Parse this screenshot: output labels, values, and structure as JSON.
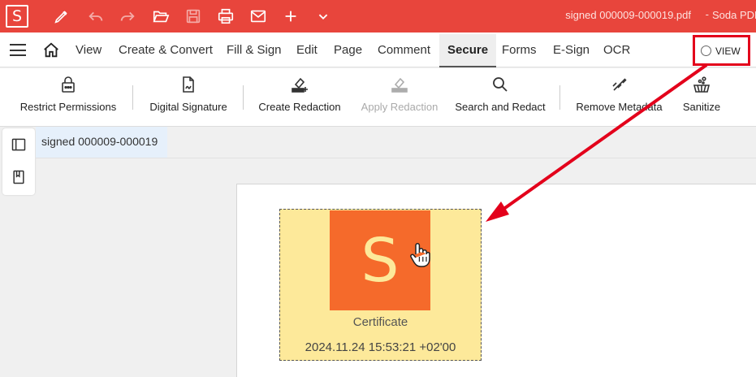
{
  "titlebar": {
    "logo": "S",
    "icons": [
      "pen-icon",
      "undo-icon",
      "redo-icon",
      "open-folder-icon",
      "save-icon",
      "print-icon",
      "mail-icon",
      "plus-icon",
      "chevron-down-icon"
    ],
    "doc_title": "signed 000009-000019.pdf",
    "separator": "-",
    "app_name": "Soda PDF",
    "bg_color": "#e8453c"
  },
  "menu": {
    "items": [
      "View",
      "Create & Convert",
      "Fill & Sign",
      "Edit",
      "Page",
      "Comment",
      "Secure",
      "Forms",
      "E-Sign",
      "OCR"
    ],
    "active": "Secure",
    "view_toggle": "VIEW"
  },
  "ribbon": {
    "buttons": [
      {
        "label": "Restrict Permissions",
        "icon": "lock-icon",
        "enabled": true
      },
      {
        "label": "Digital Signature",
        "icon": "signed-document-icon",
        "enabled": true
      },
      {
        "label": "Create Redaction",
        "icon": "redaction-create-icon",
        "enabled": true
      },
      {
        "label": "Apply Redaction",
        "icon": "redaction-apply-icon",
        "enabled": false
      },
      {
        "label": "Search and Redact",
        "icon": "search-icon",
        "enabled": true
      },
      {
        "label": "Remove Metadata",
        "icon": "remove-metadata-icon",
        "enabled": true
      },
      {
        "label": "Sanitize",
        "icon": "sanitize-icon",
        "enabled": true
      }
    ]
  },
  "document_tab": {
    "label": "signed 000009-000019"
  },
  "signature": {
    "logo_letter": "S",
    "caption": "Certificate",
    "timestamp": "2024.11.24 15:53:21 +02'00",
    "logo_color": "#f56a2b",
    "bg_color": "#fde99a"
  },
  "annotation": {
    "highlight_color": "#e3001b"
  }
}
